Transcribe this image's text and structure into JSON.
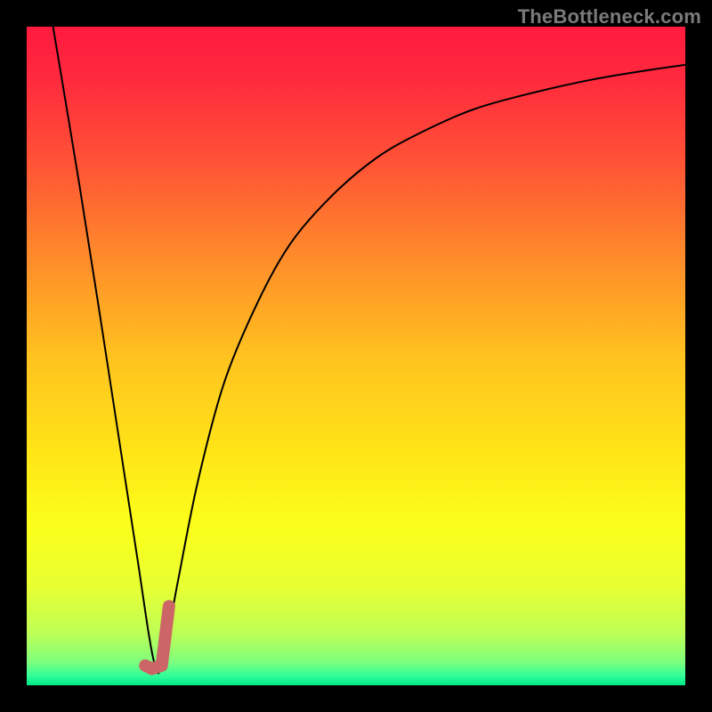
{
  "watermark": "TheBottleneck.com",
  "chart_data": {
    "type": "line",
    "title": "",
    "xlabel": "",
    "ylabel": "",
    "xlim": [
      0,
      100
    ],
    "ylim": [
      0,
      100
    ],
    "grid": false,
    "legend": false,
    "series": [
      {
        "name": "bottleneck-curve",
        "color": "#000000",
        "stroke_width": 2,
        "x": [
          4,
          8,
          11,
          13,
          15,
          17,
          18.5,
          19.5,
          20.5,
          23,
          26,
          30,
          35,
          40,
          46,
          53,
          60,
          68,
          77,
          86,
          95,
          100
        ],
        "values": [
          100,
          76,
          57,
          44,
          31,
          18,
          8,
          3,
          3,
          16,
          31,
          46,
          58,
          67,
          74,
          80,
          84,
          87.5,
          90,
          92,
          93.5,
          94.2
        ]
      },
      {
        "name": "marker-segment",
        "color": "#cc6666",
        "stroke_width": 14,
        "linecap": "round",
        "x": [
          18.0,
          19.0,
          20.5,
          21.6
        ],
        "values": [
          3.0,
          2.5,
          3.0,
          12.0
        ]
      }
    ],
    "gradient_stops": [
      {
        "offset": 0,
        "color": "#ff1a3f"
      },
      {
        "offset": 0.08,
        "color": "#ff2a3d"
      },
      {
        "offset": 0.2,
        "color": "#ff5136"
      },
      {
        "offset": 0.35,
        "color": "#ff8b2a"
      },
      {
        "offset": 0.5,
        "color": "#ffc21f"
      },
      {
        "offset": 0.65,
        "color": "#ffe617"
      },
      {
        "offset": 0.76,
        "color": "#fbff1a"
      },
      {
        "offset": 0.85,
        "color": "#e8ff33"
      },
      {
        "offset": 0.92,
        "color": "#bfff55"
      },
      {
        "offset": 0.965,
        "color": "#7dff7d"
      },
      {
        "offset": 0.985,
        "color": "#33ff99"
      },
      {
        "offset": 1.0,
        "color": "#00e88a"
      }
    ]
  }
}
